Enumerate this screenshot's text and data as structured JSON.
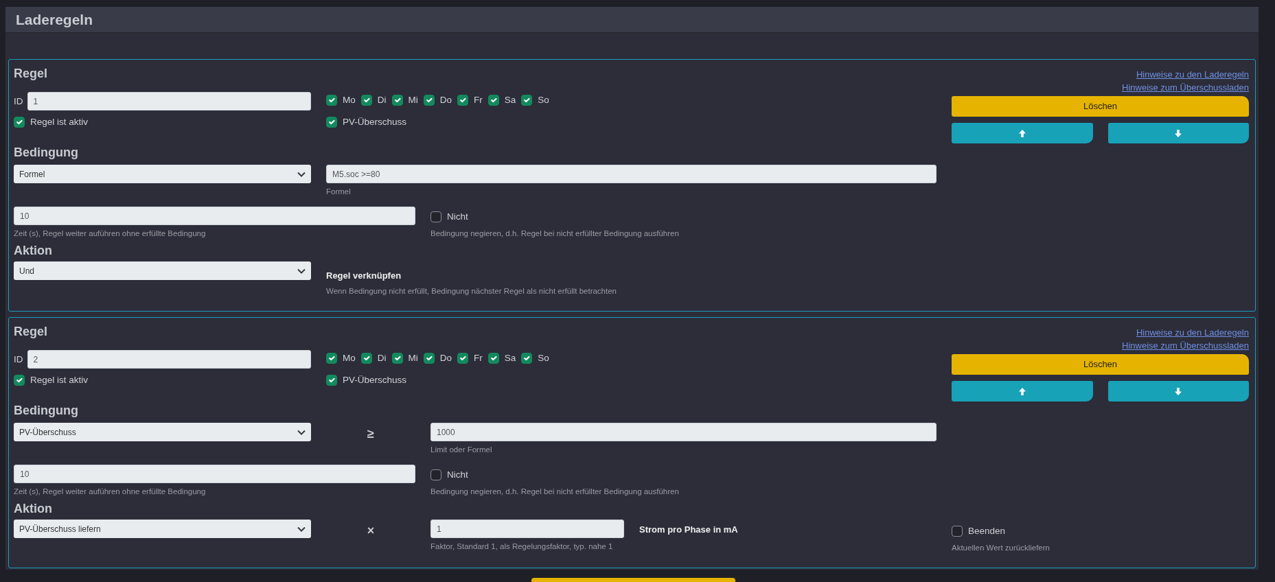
{
  "page": {
    "title": "Laderegeln"
  },
  "rules": [
    {
      "title": "Regel",
      "links": [
        "Hinweise zu den Laderegeln",
        "Hinweise zum Überschussladen"
      ],
      "delete_label": "Löschen",
      "id_label": "ID",
      "id": "1",
      "days": [
        {
          "label": "Mo",
          "checked": true
        },
        {
          "label": "Di",
          "checked": true
        },
        {
          "label": "Mi",
          "checked": true
        },
        {
          "label": "Do",
          "checked": true
        },
        {
          "label": "Fr",
          "checked": true
        },
        {
          "label": "Sa",
          "checked": true
        },
        {
          "label": "So",
          "checked": true
        }
      ],
      "active": {
        "label": "Regel ist aktiv",
        "checked": true
      },
      "pv": {
        "label": "PV-Überschuss",
        "checked": true
      },
      "condition_heading": "Bedingung",
      "condition": {
        "kind": "formula",
        "select": "Formel",
        "value": "M5.soc >=80",
        "hint": "Formel"
      },
      "time": {
        "value": "10",
        "hint": "Zeit (s), Regel weiter auführen ohne erfüllte Bedingung"
      },
      "negate": {
        "label": "Nicht",
        "checked": false,
        "hint": "Bedingung negieren, d.h. Regel bei nicht erfüllter Bedingung ausführen"
      },
      "action_heading": "Aktion",
      "action": {
        "kind": "link",
        "select": "Und",
        "label": "Regel verknüpfen",
        "hint": "Wenn Bedingung nicht erfüllt, Bedingung nächster Regel als nicht erfüllt betrachten"
      }
    },
    {
      "title": "Regel",
      "links": [
        "Hinweise zu den Laderegeln",
        "Hinweise zum Überschussladen"
      ],
      "delete_label": "Löschen",
      "id_label": "ID",
      "id": "2",
      "days": [
        {
          "label": "Mo",
          "checked": true
        },
        {
          "label": "Di",
          "checked": true
        },
        {
          "label": "Mi",
          "checked": true
        },
        {
          "label": "Do",
          "checked": true
        },
        {
          "label": "Fr",
          "checked": true
        },
        {
          "label": "Sa",
          "checked": true
        },
        {
          "label": "So",
          "checked": true
        }
      ],
      "active": {
        "label": "Regel ist aktiv",
        "checked": true
      },
      "pv": {
        "label": "PV-Überschuss",
        "checked": true
      },
      "condition_heading": "Bedingung",
      "condition": {
        "kind": "comparison",
        "select": "PV-Überschuss",
        "operator": "≥",
        "value": "1000",
        "hint": "Limit oder Formel"
      },
      "time": {
        "value": "10",
        "hint": "Zeit (s), Regel weiter auführen ohne erfüllte Bedingung"
      },
      "negate": {
        "label": "Nicht",
        "checked": false,
        "hint": "Bedingung negieren, d.h. Regel bei nicht erfüllter Bedingung ausführen"
      },
      "action_heading": "Aktion",
      "action": {
        "kind": "factor",
        "select": "PV-Überschuss liefern",
        "operator": "×",
        "value": "1",
        "hint": "Faktor, Standard 1, als Regelungsfaktor, typ. nahe 1",
        "unit_label": "Strom pro Phase in mA",
        "finish": {
          "label": "Beenden",
          "checked": false,
          "hint": "Aktuellen Wert zurückliefern"
        }
      }
    }
  ]
}
